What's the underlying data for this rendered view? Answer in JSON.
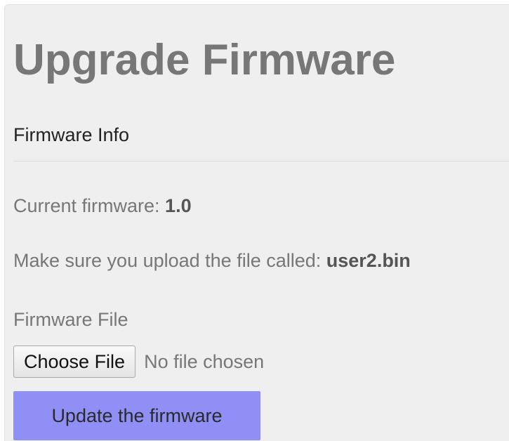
{
  "page": {
    "title": "Upgrade Firmware"
  },
  "firmware_info": {
    "section_title": "Firmware Info",
    "current_prefix": "Current firmware: ",
    "current_version": "1.0",
    "upload_prefix": "Make sure you upload the file called: ",
    "upload_filename": "user2.bin"
  },
  "upload_form": {
    "field_label": "Firmware File",
    "choose_file_label": "Choose File",
    "no_file_text": "No file chosen",
    "submit_label": "Update the firmware"
  },
  "colors": {
    "panel_background": "#efefef",
    "title_text": "#777777",
    "submit_button": "#8f8ff5"
  }
}
